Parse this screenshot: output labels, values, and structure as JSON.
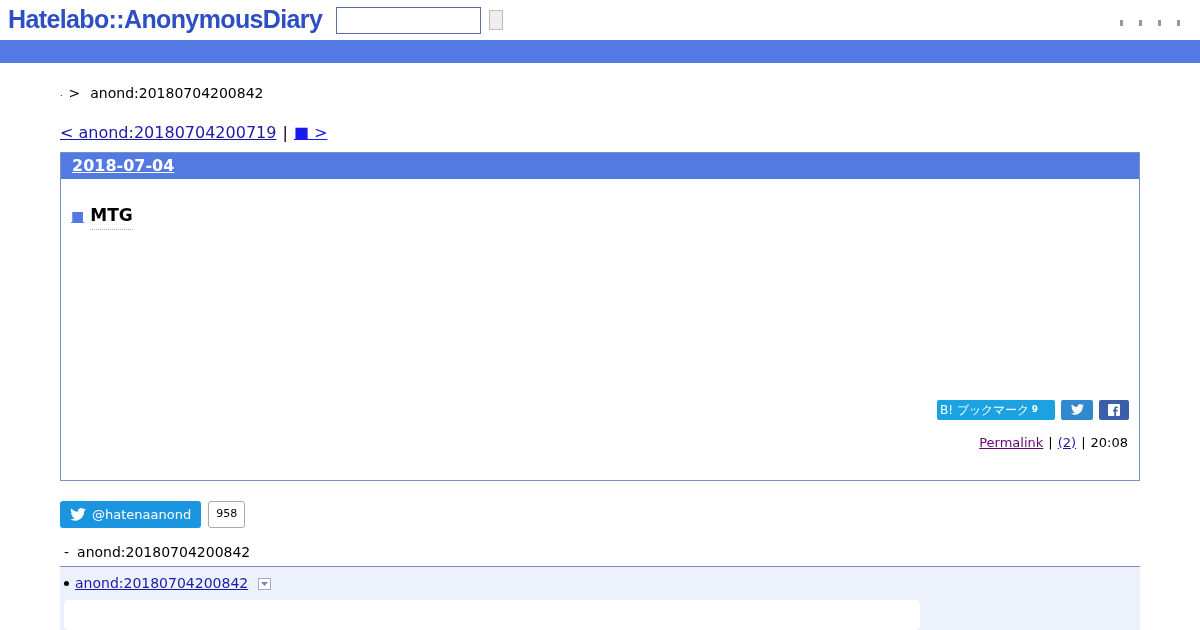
{
  "header": {
    "logo": "Hatelabo::AnonymousDiary"
  },
  "breadcrumb": {
    "home": ".",
    "separator": ">",
    "current": "anond:20180704200842"
  },
  "pager": {
    "prev": "< anond:20180704200719",
    "divider": "|",
    "next": "■ >"
  },
  "entry": {
    "date": "2018-07-04",
    "mark": "■",
    "title": "MTG",
    "bookmark": {
      "label": "B! ブックマーク",
      "count": "9"
    },
    "footer": {
      "permalink": "Permalink",
      "sep1": "|",
      "comments": "(2)",
      "sep2": "|",
      "time": "20:08"
    }
  },
  "twitter": {
    "handle": "@hatenaanond",
    "count": "958"
  },
  "refs": {
    "dash": "-",
    "title": "anond:20180704200842",
    "items": [
      {
        "link": "anond:20180704200842"
      }
    ]
  }
}
